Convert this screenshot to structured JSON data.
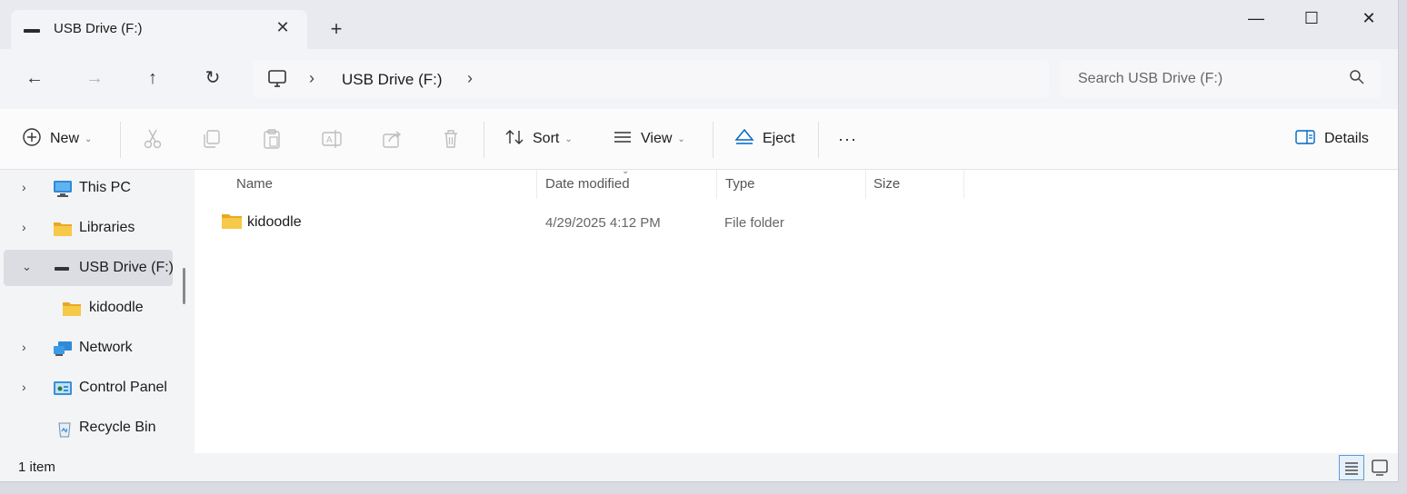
{
  "tab": {
    "title": "USB Drive (F:)",
    "close": "✕",
    "new_tab": "+"
  },
  "window_controls": {
    "minimize": "—",
    "maximize": "☐",
    "close": "✕"
  },
  "nav_buttons": {
    "back": "←",
    "forward": "→",
    "up": "↑",
    "refresh": "↻"
  },
  "address": {
    "separator": "›",
    "crumb": "USB Drive (F:)"
  },
  "search": {
    "placeholder": "Search USB Drive (F:)"
  },
  "commands": {
    "new": "New",
    "sort": "Sort",
    "view": "View",
    "eject": "Eject",
    "more": "···",
    "details": "Details",
    "caret": "⌄"
  },
  "sidebar": {
    "items": [
      {
        "label": "This PC",
        "icon": "monitor-icon",
        "expandable": true
      },
      {
        "label": "Libraries",
        "icon": "folder-library-icon",
        "expandable": true
      },
      {
        "label": "USB Drive (F:)",
        "icon": "usb-drive-icon",
        "expandable": true,
        "expanded": true,
        "selected": true
      },
      {
        "label": "kidoodle",
        "icon": "folder-icon",
        "expandable": false
      },
      {
        "label": "Network",
        "icon": "network-icon",
        "expandable": true
      },
      {
        "label": "Control Panel",
        "icon": "control-panel-icon",
        "expandable": true
      },
      {
        "label": "Recycle Bin",
        "icon": "recycle-bin-icon",
        "expandable": false
      }
    ],
    "chevron_collapsed": "›",
    "chevron_expanded": "⌄"
  },
  "columns": {
    "name": "Name",
    "date": "Date modified",
    "type": "Type",
    "size": "Size"
  },
  "files": [
    {
      "name": "kidoodle",
      "date": "4/29/2025 4:12 PM",
      "type": "File folder",
      "size": ""
    }
  ],
  "status": {
    "count": "1 item"
  },
  "colors": {
    "folder": "#f4c430",
    "accent": "#0067c0",
    "selected": "#dcdde2"
  }
}
